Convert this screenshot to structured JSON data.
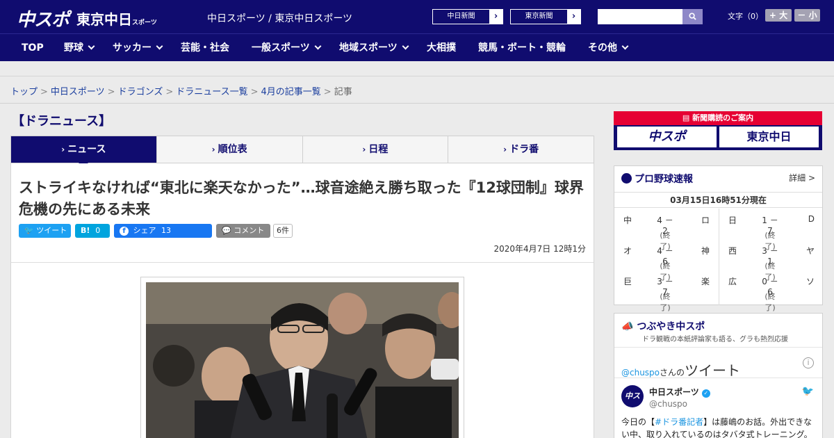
{
  "header": {
    "logo_main": "中スポ",
    "logo_sub": "東京中日",
    "logo_sub_small": "スポーツ",
    "site_title": "中日スポーツ / 東京中日スポーツ",
    "ext_links": [
      "中日新聞",
      "東京新聞"
    ],
    "search_placeholder": "",
    "font_label": "文字（0）",
    "font_up": "+ 大",
    "font_down": "－ 小"
  },
  "nav": {
    "items": [
      "TOP",
      "野球",
      "サッカー",
      "芸能・社会",
      "一般スポーツ",
      "地域スポーツ",
      "大相撲",
      "競馬・ボート・競輪",
      "その他"
    ]
  },
  "breadcrumb": {
    "links": [
      "トップ",
      "中日スポーツ",
      "ドラゴンズ",
      "ドラニュース一覧",
      "4月の記事一覧"
    ],
    "current": "記事"
  },
  "section_title": "【ドラニュース】",
  "tabs": [
    "ニュース",
    "順位表",
    "日程",
    "ドラ番"
  ],
  "article": {
    "headline": "ストライキなければ“東北に楽天なかった”…球音途絶え勝ち取った『12球団制』球界危機の先にある未来",
    "share": {
      "tweet": "ツイート",
      "hatena_label": "B!",
      "hatena_count": "0",
      "fb_label": "シェア",
      "fb_count": "13",
      "comment_label": "コメント",
      "comment_count": "6件"
    },
    "date": "2020年4月7日 12時1分"
  },
  "subscribe": {
    "title": "新聞購読のご案内",
    "logo1": "中スポ",
    "logo2": "東京中日"
  },
  "scores": {
    "title": "プロ野球速報",
    "detail": "詳細 >",
    "time": "03月15日16時51分現在",
    "left": [
      {
        "t1": "中",
        "score": "4 － 2",
        "t2": "ロ",
        "status": "(終了)"
      },
      {
        "t1": "オ",
        "score": "4 － 6",
        "t2": "神",
        "status": "(終了)"
      },
      {
        "t1": "巨",
        "score": "3 － 7",
        "t2": "楽",
        "status": "(終了)"
      }
    ],
    "right": [
      {
        "t1": "日",
        "score": "1 － 7",
        "t2": "D",
        "status": "(終了)"
      },
      {
        "t1": "西",
        "score": "3 － 1",
        "t2": "ヤ",
        "status": "(終了)"
      },
      {
        "t1": "広",
        "score": "0 － 6",
        "t2": "ソ",
        "status": "(終了)"
      }
    ]
  },
  "tweets": {
    "title": "つぶやき中スポ",
    "subtitle": "ドラ観戦の本紙評論家も語る、グラも熱烈応援",
    "handle": "@chuspo",
    "handle_suffix": "さんの",
    "handle_big": "ツイート",
    "info": "i",
    "avatar": "中スポ",
    "name": "中日スポーツ",
    "id": "@chuspo",
    "text_pre": "今日の【",
    "text_tag": "#ドラ番記者",
    "text_post": "】は藤嶋のお話。外出できない中、取り入れているのはタバタ式トレーニング。"
  }
}
